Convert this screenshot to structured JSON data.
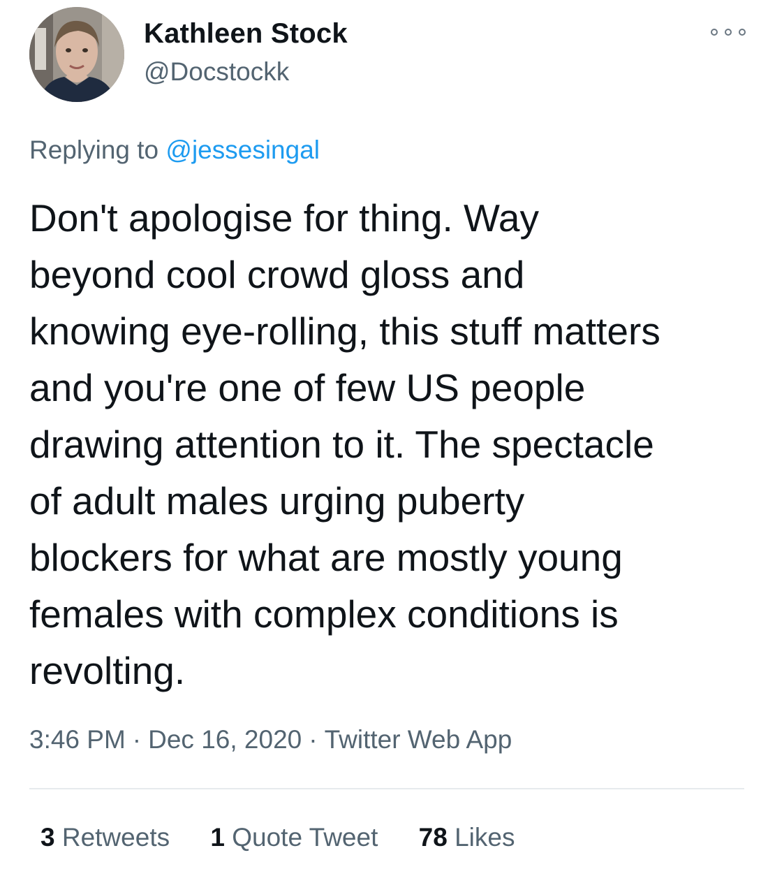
{
  "author": {
    "display_name": "Kathleen Stock",
    "handle": "@Docstockk",
    "avatar_icon": "user-avatar"
  },
  "more_icon": "more-options-icon",
  "reply": {
    "prefix": "Replying to",
    "mention": "@jessesingal"
  },
  "tweet": {
    "lines": [
      "Don't apologise for thing. Way",
      "beyond cool crowd gloss and",
      "knowing eye-rolling, this stuff matters",
      "and you're one of few US people",
      "drawing attention to it. The spectacle",
      "of adult males urging puberty",
      "blockers for what are mostly young",
      "females with complex conditions is",
      "revolting."
    ]
  },
  "meta": {
    "time": "3:46 PM",
    "separator": "·",
    "date": "Dec 16, 2020",
    "source": "Twitter Web App"
  },
  "stats": {
    "retweets_count": "3",
    "retweets_label": "Retweets",
    "quotes_count": "1",
    "quotes_label": "Quote Tweet",
    "likes_count": "78",
    "likes_label": "Likes"
  },
  "colors": {
    "text": "#0f1419",
    "secondary": "#536471",
    "link": "#1d9bf0",
    "divider": "#e6eaed"
  }
}
